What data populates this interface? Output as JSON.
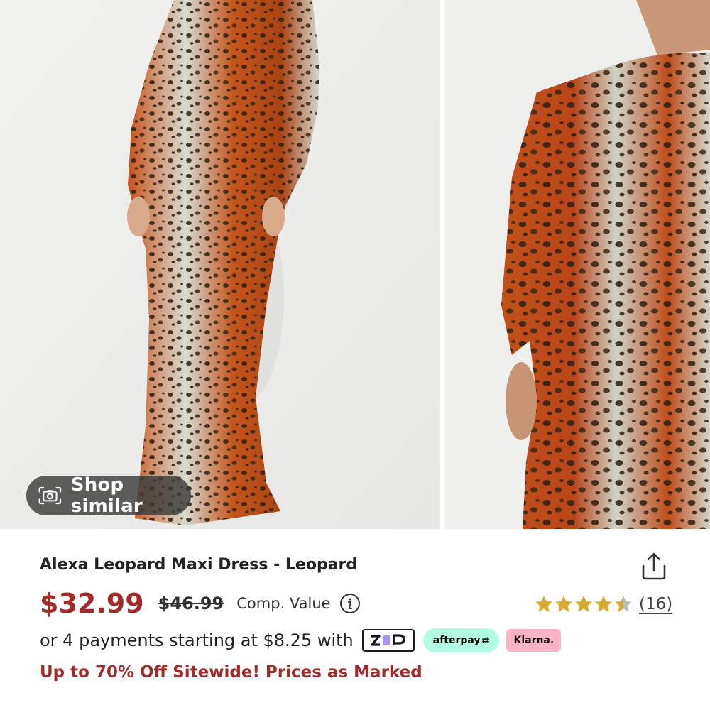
{
  "gallery": {
    "images": [
      {
        "icon": "model-full-length-photo"
      },
      {
        "icon": "model-closeup-photo"
      }
    ],
    "shop_similar": {
      "label": "Shop similar",
      "icon": "camera-icon"
    }
  },
  "product": {
    "title": "Alexa Leopard Maxi Dress - Leopard",
    "share_icon": "share-icon"
  },
  "pricing": {
    "current_price": "$32.99",
    "original_price": "$46.99",
    "comp_value_label": "Comp. Value",
    "info_icon": "info-icon",
    "price_color": "#a32a2a"
  },
  "rating": {
    "stars": 4.5,
    "max_stars": 5,
    "review_count": "(16)",
    "star_color": "#d6ab2e"
  },
  "payments": {
    "text": "or 4 payments starting at $8.25 with",
    "providers": [
      {
        "name": "zip",
        "label": "zip"
      },
      {
        "name": "afterpay",
        "label": "afterpay",
        "color": "#b2fce4"
      },
      {
        "name": "klarna",
        "label": "Klarna.",
        "color": "#ffb3c7"
      }
    ]
  },
  "promo": {
    "text": "Up to 70% Off Sitewide! Prices as Marked"
  }
}
